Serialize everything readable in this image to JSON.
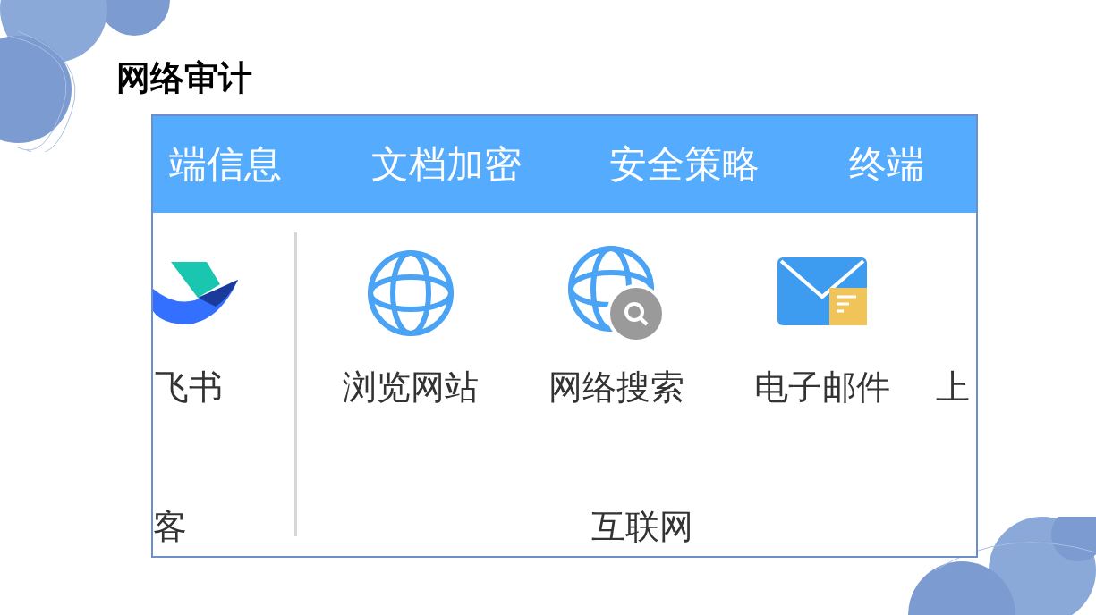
{
  "title": "网络审计",
  "screenshot": {
    "tabs": [
      {
        "label": "端信息"
      },
      {
        "label": "文档加密"
      },
      {
        "label": "安全策略"
      },
      {
        "label": "终端"
      }
    ],
    "groups": [
      {
        "label": "客",
        "items": [
          {
            "kind": "bird",
            "label": "飞书"
          }
        ]
      },
      {
        "label": "互联网",
        "items": [
          {
            "kind": "globe",
            "label": "浏览网站"
          },
          {
            "kind": "globe-search",
            "label": "网络搜索"
          },
          {
            "kind": "mail",
            "label": "电子邮件"
          },
          {
            "kind": "cut",
            "label": "上"
          }
        ]
      }
    ]
  }
}
